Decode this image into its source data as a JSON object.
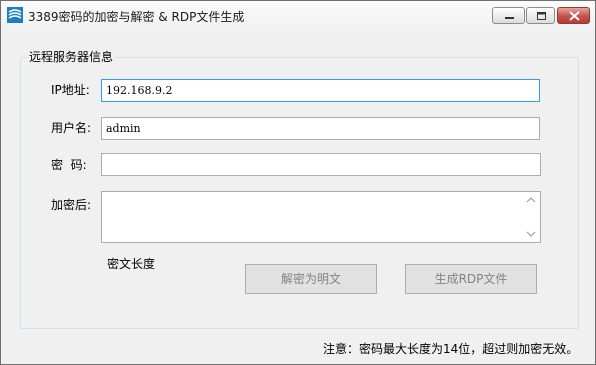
{
  "window": {
    "title": "3389密码的加密与解密 & RDP文件生成",
    "icon": "app-logo-icon"
  },
  "group": {
    "legend": "远程服务器信息"
  },
  "form": {
    "ip_label": "IP地址:",
    "ip_value": "192.168.9.2",
    "user_label": "用户名:",
    "user_value": "admin",
    "password_label": "密  码:",
    "password_value": "",
    "encrypted_label": "加密后:",
    "encrypted_value": "",
    "cipher_length_label": "密文长度"
  },
  "buttons": {
    "decrypt": "解密为明文",
    "generate_rdp": "生成RDP文件"
  },
  "note": "注意：密码最大长度为14位，超过则加密无效。",
  "colors": {
    "focus_border": "#3399ff",
    "close_button": "#c75050",
    "disabled_text": "#838383"
  }
}
